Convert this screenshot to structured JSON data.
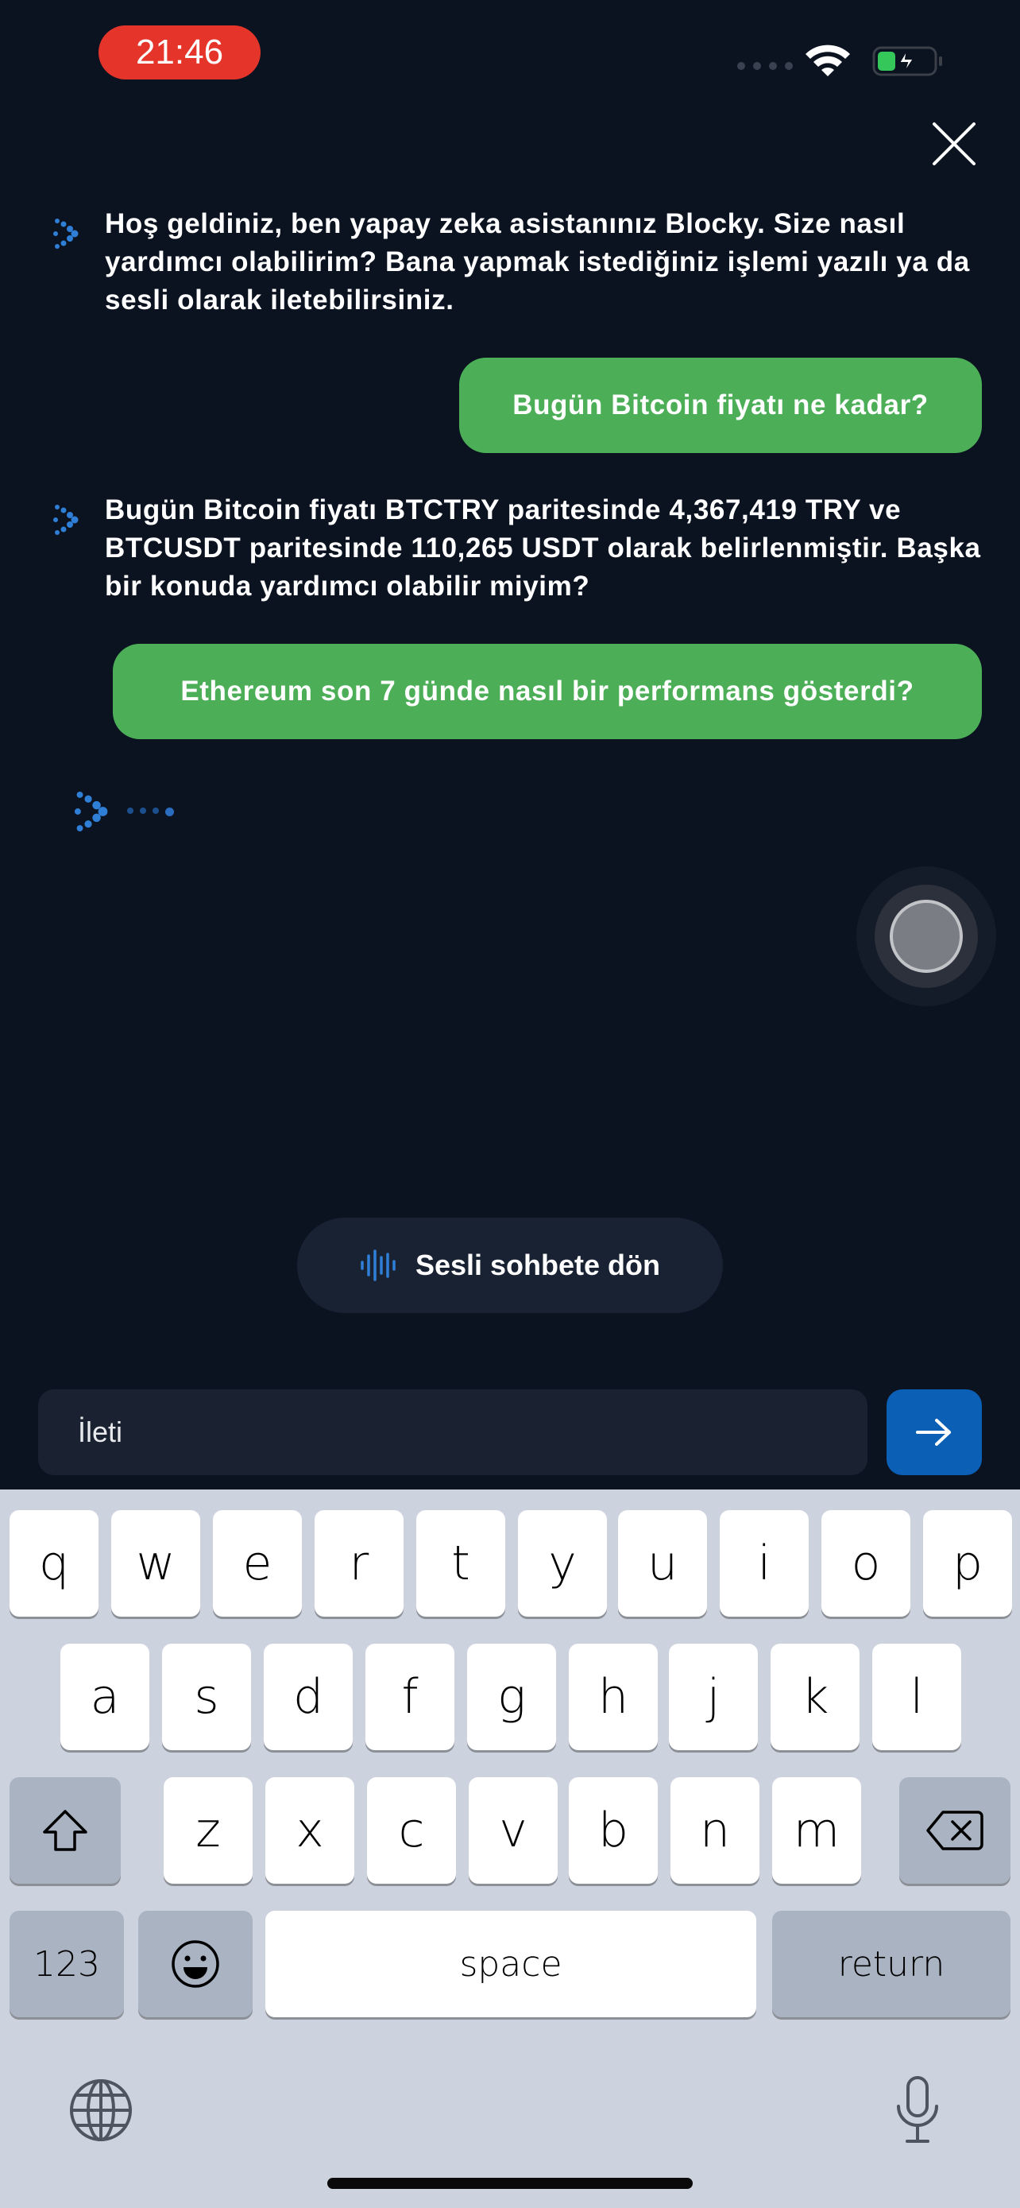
{
  "status_bar": {
    "time": "21:46"
  },
  "messages": [
    {
      "role": "bot",
      "text": "Hoş geldiniz, ben yapay zeka asistanınız Blocky. Size nasıl yardımcı olabilirim? Bana yapmak istediğiniz işlemi yazılı ya da sesli olarak iletebilirsiniz."
    },
    {
      "role": "user",
      "text": "Bugün Bitcoin fiyatı ne kadar?"
    },
    {
      "role": "bot",
      "text": "Bugün Bitcoin fiyatı BTCTRY paritesinde 4,367,419 TRY ve BTCUSDT paritesinde 110,265 USDT olarak belirlenmiştir. Başka bir konuda yardımcı olabilir miyim?"
    },
    {
      "role": "user",
      "text": "Ethereum son 7 günde nasıl bir performans gösterdi?"
    }
  ],
  "voice_button": {
    "label": "Sesli sohbete dön"
  },
  "composer": {
    "placeholder": "İleti"
  },
  "keyboard": {
    "row1": [
      "q",
      "w",
      "e",
      "r",
      "t",
      "y",
      "u",
      "i",
      "o",
      "p"
    ],
    "row2": [
      "a",
      "s",
      "d",
      "f",
      "g",
      "h",
      "j",
      "k",
      "l"
    ],
    "row3": [
      "z",
      "x",
      "c",
      "v",
      "b",
      "n",
      "m"
    ],
    "numbers_label": "123",
    "space_label": "space",
    "return_label": "return"
  },
  "colors": {
    "background": "#0b1220",
    "user_bubble": "#4caf58",
    "send_button": "#0b5fb5",
    "time_pill": "#e5352b"
  },
  "icons": [
    "close-icon",
    "blocky-logo-icon",
    "sound-wave-icon",
    "arrow-right-icon",
    "shift-icon",
    "backspace-icon",
    "emoji-icon",
    "globe-icon",
    "microphone-icon",
    "wifi-icon",
    "battery-icon"
  ]
}
